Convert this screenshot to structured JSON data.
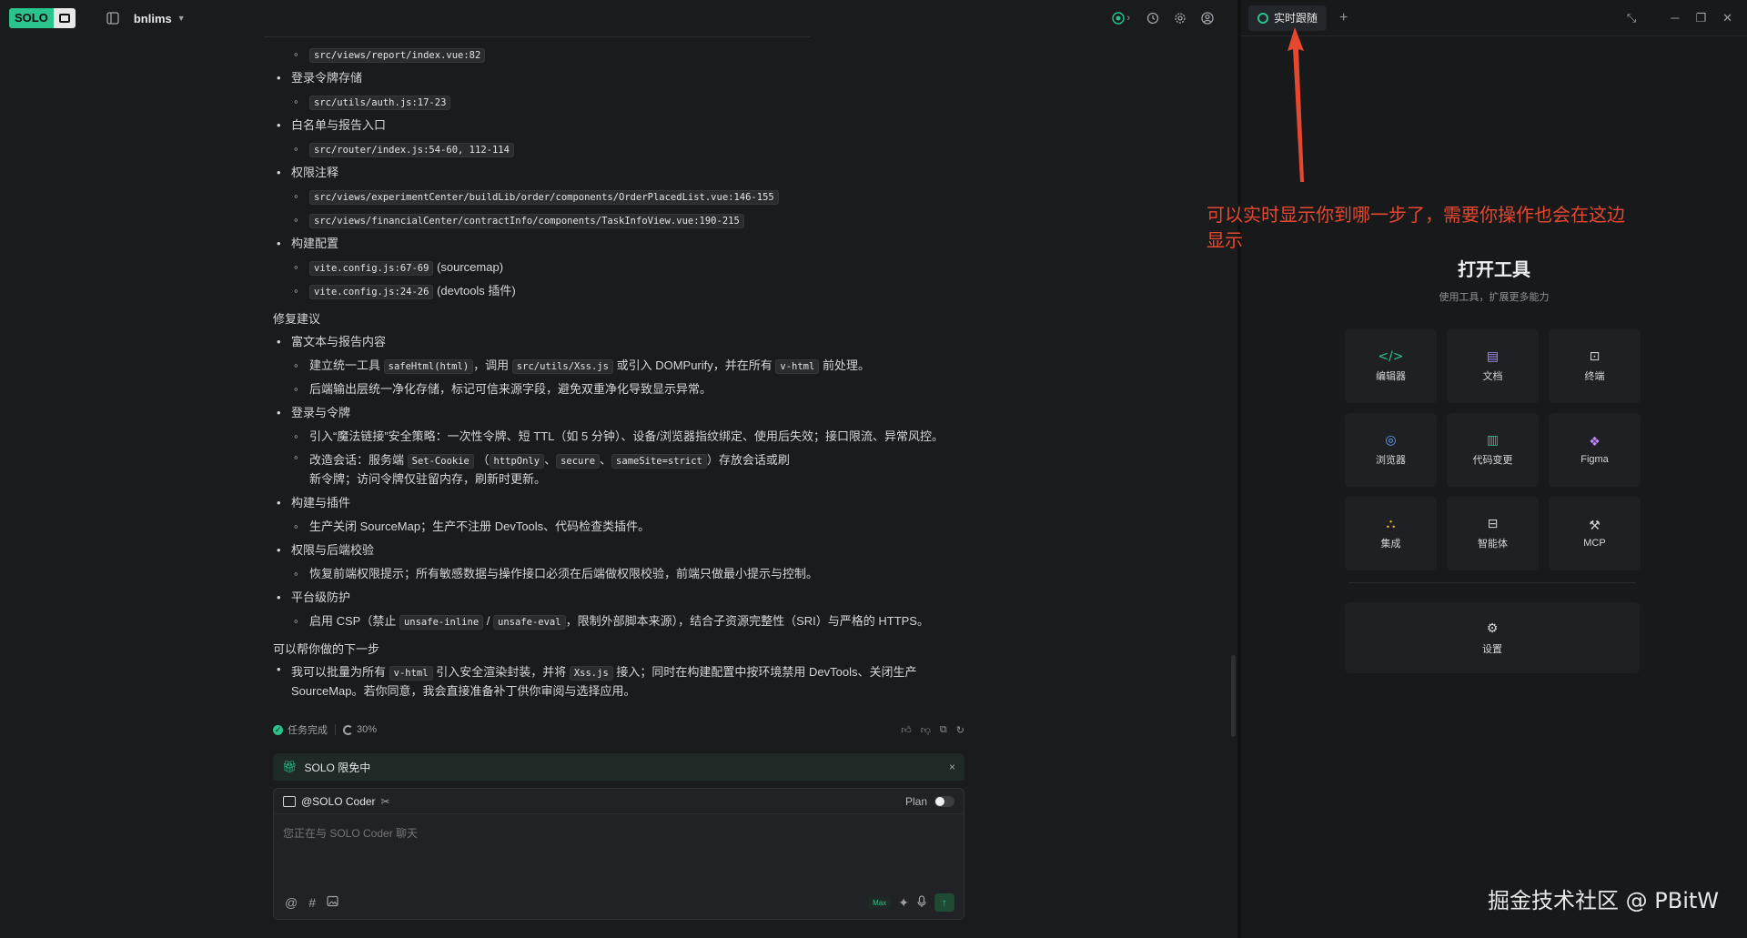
{
  "topbar": {
    "logo_text": "SOLO",
    "project_name": "bnlims"
  },
  "chat": {
    "item0_code": "src/views/report/index.vue:82",
    "groups": [
      {
        "title": "登录令牌存储",
        "codes": [
          "src/utils/auth.js:17-23"
        ]
      },
      {
        "title": "白名单与报告入口",
        "codes": [
          "src/router/index.js:54-60, 112-114"
        ]
      },
      {
        "title": "权限注释",
        "codes": [
          "src/views/experimentCenter/buildLib/order/components/OrderPlacedList.vue:146-155",
          "src/views/financialCenter/contractInfo/components/TaskInfoView.vue:190-215"
        ]
      },
      {
        "title": "构建配置",
        "codes": [
          "vite.config.js:67-69",
          "vite.config.js:24-26"
        ],
        "notes": [
          "(sourcemap)",
          "(devtools 插件)"
        ]
      }
    ],
    "fix_title": "修复建议",
    "fix": {
      "g1_title": "富文本与报告内容",
      "g1_a_1": "建立统一工具",
      "g1_a_code1": "safeHtml(html)",
      "g1_a_2": "，调用",
      "g1_a_code2": "src/utils/Xss.js",
      "g1_a_3": "或引入 DOMPurify，并在所有",
      "g1_a_code3": "v-html",
      "g1_a_4": "前处理。",
      "g1_b": "后端输出层统一净化存储，标记可信来源字段，避免双重净化导致显示异常。",
      "g2_title": "登录与令牌",
      "g2_a": "引入“魔法链接”安全策略：一次性令牌、短 TTL（如 5 分钟）、设备/浏览器指纹绑定、使用后失效；接口限流、异常风控。",
      "g2_b_1": "改造会话：服务端",
      "g2_b_code1": "Set-Cookie",
      "g2_b_2": "（",
      "g2_b_code2": "httpOnly",
      "g2_b_3": "、",
      "g2_b_code3": "secure",
      "g2_b_4": "、",
      "g2_b_code4": "sameSite=strict",
      "g2_b_5": "）存放会话或刷新令牌；访问令牌仅驻留内存，刷新时更新。",
      "g3_title": "构建与插件",
      "g3_a": "生产关闭 SourceMap；生产不注册 DevTools、代码检查类插件。",
      "g4_title": "权限与后端校验",
      "g4_a": "恢复前端权限提示；所有敏感数据与操作接口必须在后端做权限校验，前端只做最小提示与控制。",
      "g5_title": "平台级防护",
      "g5_a_1": "启用 CSP（禁止",
      "g5_a_code1": "unsafe-inline",
      "g5_a_2": "/",
      "g5_a_code2": "unsafe-eval",
      "g5_a_3": "，限制外部脚本来源），结合子资源完整性（SRI）与严格的 HTTPS。"
    },
    "next_title": "可以帮你做的下一步",
    "next_1": "我可以批量为所有",
    "next_code1": "v-html",
    "next_2": "引入安全渲染封装，并将",
    "next_code2": "Xss.js",
    "next_3": "接入；同时在构建配置中按环境禁用 DevTools、关闭生产 SourceMap。若你同意，我会直接准备补丁供你审阅与选择应用。"
  },
  "meta": {
    "status": "任务完成",
    "progress": "30%"
  },
  "promo": {
    "text": "SOLO 限免中",
    "close": "×"
  },
  "composer": {
    "agent": "@SOLO Coder",
    "plan_label": "Plan",
    "placeholder": "您正在与 SOLO Coder 聊天",
    "max_label": "Max"
  },
  "panel": {
    "tab_label": "实时跟随",
    "annotation": "可以实时显示你到哪一步了，需要你操作也会在这边显示",
    "title": "打开工具",
    "subtitle": "使用工具，扩展更多能力",
    "tools": [
      {
        "label": "编辑器",
        "icon": "code-icon",
        "color": "#2ac38c"
      },
      {
        "label": "文档",
        "icon": "document-icon",
        "color": "#a78bfa"
      },
      {
        "label": "终端",
        "icon": "terminal-icon",
        "color": "#cfd2d6"
      },
      {
        "label": "浏览器",
        "icon": "compass-icon",
        "color": "#60a5fa"
      },
      {
        "label": "代码变更",
        "icon": "diff-icon",
        "color": "#2ac38c"
      },
      {
        "label": "Figma",
        "icon": "figma-icon",
        "color": "#c084fc"
      },
      {
        "label": "集成",
        "icon": "integration-icon",
        "color": "#fbbf24"
      },
      {
        "label": "智能体",
        "icon": "agent-icon",
        "color": "#cfd2d6"
      },
      {
        "label": "MCP",
        "icon": "wrench-icon",
        "color": "#cfd2d6"
      }
    ],
    "settings_label": "设置"
  },
  "watermark": "掘金技术社区 @ PBitW",
  "colors": {
    "accent": "#2ac38c",
    "annotation": "#e5482f"
  }
}
